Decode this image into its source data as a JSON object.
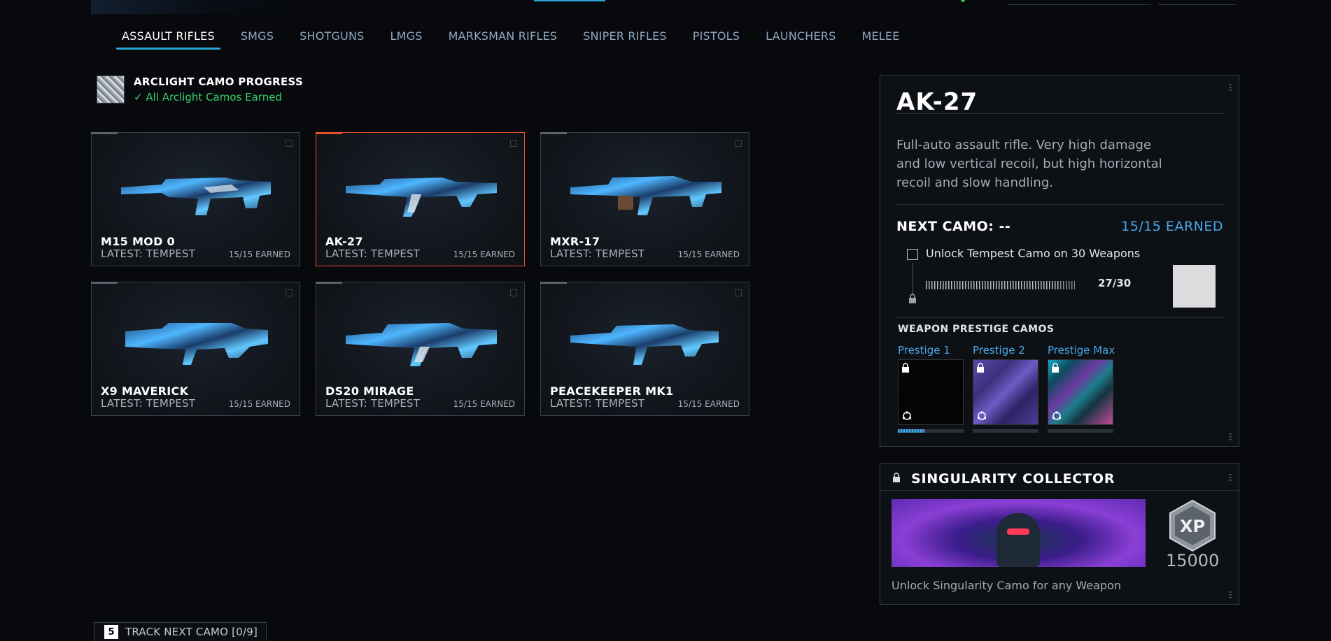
{
  "tabs": [
    {
      "label": "ASSAULT RIFLES",
      "active": true
    },
    {
      "label": "SMGS"
    },
    {
      "label": "SHOTGUNS"
    },
    {
      "label": "LMGS"
    },
    {
      "label": "MARKSMAN RIFLES"
    },
    {
      "label": "SNIPER RIFLES"
    },
    {
      "label": "PISTOLS"
    },
    {
      "label": "LAUNCHERS"
    },
    {
      "label": "MELEE"
    }
  ],
  "progress": {
    "title": "ARCLIGHT CAMO PROGRESS",
    "status_icon": "check-icon",
    "status": "All Arclight Camos Earned"
  },
  "weapons": [
    {
      "name": "M15 MOD 0",
      "latest": "LATEST: TEMPEST",
      "earned": "15/15 EARNED"
    },
    {
      "name": "AK-27",
      "latest": "LATEST: TEMPEST",
      "earned": "15/15 EARNED",
      "selected": true
    },
    {
      "name": "MXR-17",
      "latest": "LATEST: TEMPEST",
      "earned": "15/15 EARNED"
    },
    {
      "name": "X9 MAVERICK",
      "latest": "LATEST: TEMPEST",
      "earned": "15/15 EARNED"
    },
    {
      "name": "DS20 MIRAGE",
      "latest": "LATEST: TEMPEST",
      "earned": "15/15 EARNED"
    },
    {
      "name": "PEACEKEEPER MK1",
      "latest": "LATEST: TEMPEST",
      "earned": "15/15 EARNED"
    }
  ],
  "detail": {
    "name": "AK-27",
    "description": "Full-auto assault rifle. Very high damage and low vertical recoil, but high horizontal recoil and slow handling.",
    "next_camo": "NEXT CAMO: --",
    "earned": "15/15 EARNED",
    "challenge": {
      "text": "Unlock Tempest Camo on 30 Weapons",
      "count": "27/30",
      "progress": 0.9
    },
    "prestige_title": "WEAPON PRESTIGE CAMOS",
    "prestige": [
      {
        "label": "Prestige 1",
        "progress": 0.4
      },
      {
        "label": "Prestige 2",
        "progress": 0
      },
      {
        "label": "Prestige Max",
        "progress": 0
      }
    ]
  },
  "singularity": {
    "title": "SINGULARITY COLLECTOR",
    "xp_icon": "xp-badge-icon",
    "xp_value": "15000",
    "unlock_text": "Unlock Singularity Camo for any Weapon"
  },
  "track": {
    "key": "5",
    "label": "TRACK NEXT CAMO [0/9]"
  },
  "colors": {
    "accent_blue": "#2aa6d8",
    "earned_blue": "#4aa7e6",
    "selected_orange": "#e0542a",
    "success_green": "#39d16b"
  }
}
